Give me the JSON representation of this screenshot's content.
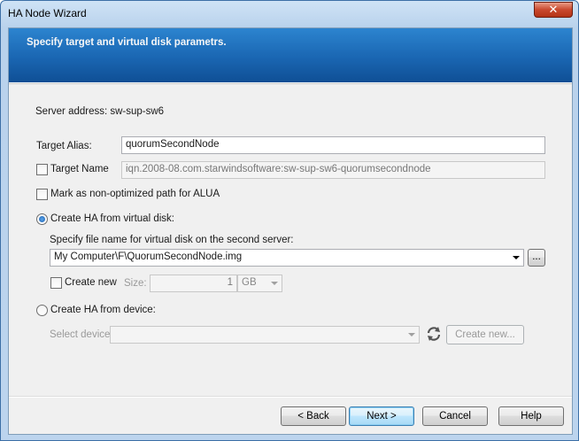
{
  "window": {
    "title": "HA Node Wizard",
    "close_glyph": "✕"
  },
  "banner": {
    "title": "Specify target and virtual disk parametrs."
  },
  "form": {
    "server_address": "Server address: sw-sup-sw6",
    "target_alias_label": "Target Alias:",
    "target_alias_value": "quorumSecondNode",
    "target_name_label": "Target Name",
    "target_name_value": "iqn.2008-08.com.starwindsoftware:sw-sup-sw6-quorumsecondnode",
    "target_name_checked": false,
    "alua_label": "Mark as non-optimized path for ALUA",
    "alua_checked": false,
    "ha_virtual_disk_label": "Create HA from virtual disk:",
    "ha_virtual_disk_selected": true,
    "file_name_label": "Specify file name for virtual disk on the second server:",
    "file_path": "My Computer\\F\\QuorumSecondNode.img",
    "browse_label": "...",
    "create_new_label": "Create new",
    "create_new_checked": false,
    "size_label": "Size:",
    "size_value": "1",
    "size_unit": "GB",
    "ha_device_label": "Create HA from device:",
    "ha_device_selected": false,
    "select_device_label": "Select device",
    "select_device_value": "",
    "create_new_device_label": "Create new..."
  },
  "buttons": {
    "back": "< Back",
    "next": "Next >",
    "cancel": "Cancel",
    "help": "Help"
  },
  "icons": {
    "refresh": "refresh-icon"
  }
}
